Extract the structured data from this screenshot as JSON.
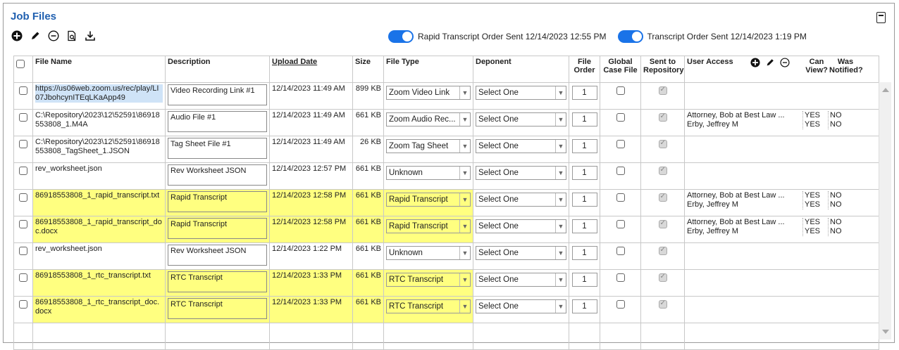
{
  "title": "Job Files",
  "toolbar": {
    "icons": [
      "add-icon",
      "edit-icon",
      "remove-icon",
      "preview-icon",
      "download-icon"
    ]
  },
  "toggles": [
    {
      "label": "Rapid Transcript Order Sent 12/14/2023 12:55 PM",
      "on": true
    },
    {
      "label": "Transcript Order Sent 12/14/2023 1:19 PM",
      "on": true
    }
  ],
  "columns": {
    "file_name": "File Name",
    "description": "Description",
    "upload_date": "Upload Date",
    "size": "Size",
    "file_type": "File Type",
    "deponent": "Deponent",
    "file_order": "File Order",
    "global_case_file": "Global Case File",
    "sent_to_repository": "Sent to Repository",
    "user_access": "User Access",
    "can_view": "Can View?",
    "was_notified": "Was Notified?"
  },
  "highlight_color": "#ffff80",
  "rows": [
    {
      "file": "https://us06web.zoom.us/rec/play/LI07JbohcynITEqLKaApp49",
      "desc": "Video Recording Link #1",
      "date": "12/14/2023 11:49 AM",
      "size": "899 KB",
      "type": "Zoom Video Link",
      "deponent": "Select One",
      "order": "1"
    },
    {
      "file": "C:\\Repository\\2023\\12\\52591\\86918553808_1.M4A",
      "desc": "Audio File #1",
      "date": "12/14/2023 11:49 AM",
      "size": "661 KB",
      "type": "Zoom Audio Rec...",
      "deponent": "Select One",
      "order": "1",
      "ua1": "Attorney, Bob at Best Law ...",
      "ua2": "Erby, Jeffrey M",
      "cv1": "YES",
      "cv2": "YES",
      "wn1": "NO",
      "wn2": "NO"
    },
    {
      "file": "C:\\Repository\\2023\\12\\52591\\86918553808_TagSheet_1.JSON",
      "desc": "Tag Sheet File #1",
      "date": "12/14/2023 11:49 AM",
      "size": "26 KB",
      "type": "Zoom Tag Sheet",
      "deponent": "Select One",
      "order": "1"
    },
    {
      "file": "rev_worksheet.json",
      "desc": "Rev Worksheet JSON",
      "date": "12/14/2023 12:57 PM",
      "size": "661 KB",
      "type": "Unknown",
      "deponent": "Select One",
      "order": "1"
    },
    {
      "file": "86918553808_1_rapid_transcript.txt",
      "desc": "Rapid Transcript",
      "date": "12/14/2023 12:58 PM",
      "size": "661 KB",
      "type": "Rapid Transcript",
      "deponent": "Select One",
      "order": "1",
      "ua1": "Attorney, Bob at Best Law ...",
      "ua2": "Erby, Jeffrey M",
      "cv1": "YES",
      "cv2": "YES",
      "wn1": "NO",
      "wn2": "NO"
    },
    {
      "file": "86918553808_1_rapid_transcript_doc.docx",
      "desc": "Rapid Transcript",
      "date": "12/14/2023 12:58 PM",
      "size": "661 KB",
      "type": "Rapid Transcript",
      "deponent": "Select One",
      "order": "1",
      "ua1": "Attorney, Bob at Best Law ...",
      "ua2": "Erby, Jeffrey M",
      "cv1": "YES",
      "cv2": "YES",
      "wn1": "NO",
      "wn2": "NO"
    },
    {
      "file": "rev_worksheet.json",
      "desc": "Rev Worksheet JSON",
      "date": "12/14/2023 1:22 PM",
      "size": "661 KB",
      "type": "Unknown",
      "deponent": "Select One",
      "order": "1"
    },
    {
      "file": "86918553808_1_rtc_transcript.txt",
      "desc": "RTC Transcript",
      "date": "12/14/2023 1:33 PM",
      "size": "661 KB",
      "type": "RTC Transcript",
      "deponent": "Select One",
      "order": "1"
    },
    {
      "file": "86918553808_1_rtc_transcript_doc.docx",
      "desc": "RTC Transcript",
      "date": "12/14/2023 1:33 PM",
      "size": "661 KB",
      "type": "RTC Transcript",
      "deponent": "Select One",
      "order": "1"
    }
  ]
}
